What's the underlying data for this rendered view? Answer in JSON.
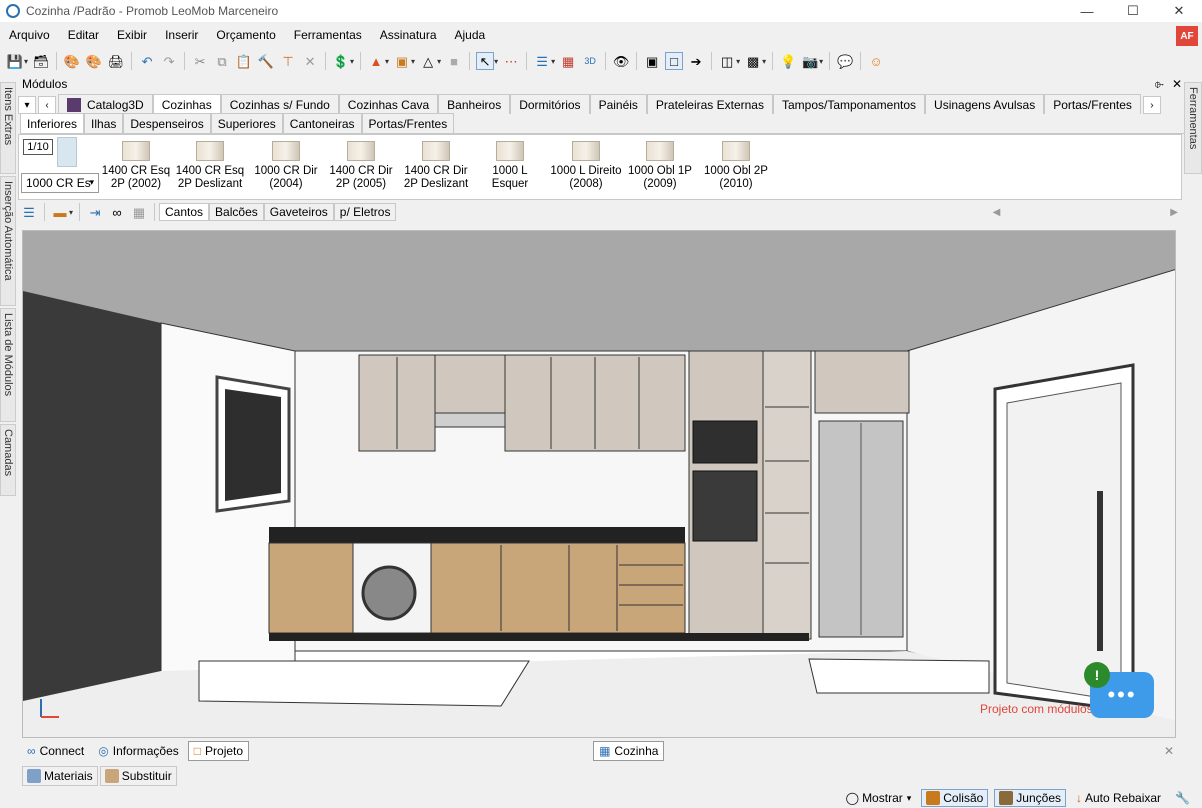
{
  "window": {
    "title": "Cozinha /Padrão - Promob LeoMob Marceneiro",
    "minimize": "—",
    "maximize": "☐",
    "close": "✕"
  },
  "menu": [
    "Arquivo",
    "Editar",
    "Exibir",
    "Inserir",
    "Orçamento",
    "Ferramentas",
    "Assinatura",
    "Ajuda"
  ],
  "avatar": "AF",
  "left_strip": [
    "Itens Extras",
    "Inserção Automática",
    "Lista de Módulos",
    "Camadas"
  ],
  "right_strip": [
    "Ferramentas"
  ],
  "modules": {
    "title": "Módulos",
    "pin": "⌱",
    "close": "✕",
    "catalog_tabs": [
      "Catalog3D",
      "Cozinhas",
      "Cozinhas s/ Fundo",
      "Cozinhas Cava",
      "Banheiros",
      "Dormitórios",
      "Painéis",
      "Prateleiras Externas",
      "Tampos/Tamponamentos",
      "Usinagens Avulsas",
      "Portas/Frentes"
    ],
    "active_catalog_tab": "Cozinhas",
    "sub_tabs": [
      "Inferiores",
      "Ilhas",
      "Despenseiros",
      "Superiores",
      "Cantoneiras",
      "Portas/Frentes"
    ],
    "active_sub_tab": "Inferiores",
    "pager": "1/10",
    "combo_value": "1000 CR Es",
    "items": [
      {
        "label": "1400 CR Esq 2P (2002)"
      },
      {
        "label": "1400 CR Esq 2P Deslizant"
      },
      {
        "label": "1000 CR Dir (2004)"
      },
      {
        "label": "1400 CR Dir 2P (2005)"
      },
      {
        "label": "1400 CR Dir 2P Deslizant"
      },
      {
        "label": "1000 L Esquer"
      },
      {
        "label": "1000 L Direito (2008)"
      },
      {
        "label": "1000 Obl 1P (2009)"
      },
      {
        "label": "1000 Obl 2P (2010)"
      }
    ],
    "filter_tabs": [
      "Cantos",
      "Balcões",
      "Gaveteiros",
      "p/ Eletros"
    ],
    "active_filter_tab": "Cantos"
  },
  "viewport": {
    "notification": "Projeto com módulos inválidos",
    "chat_glyph": "•••",
    "alert_glyph": "!"
  },
  "bottom": {
    "project_tabs": [
      "Connect",
      "Informações",
      "Projeto"
    ],
    "active_project_tab": "Projeto",
    "scene_tab": "Cozinha",
    "close": "✕",
    "tabs": [
      "Materiais",
      "Substituir"
    ]
  },
  "status": {
    "show": "Mostrar",
    "collision": "Colisão",
    "joints": "Junções",
    "auto_lower": "Auto Rebaixar"
  },
  "colors": {
    "accent": "#3d9be9",
    "avatar": "#e0463a",
    "cabinet": "#d0c8bf",
    "wood": "#c8a67a"
  }
}
